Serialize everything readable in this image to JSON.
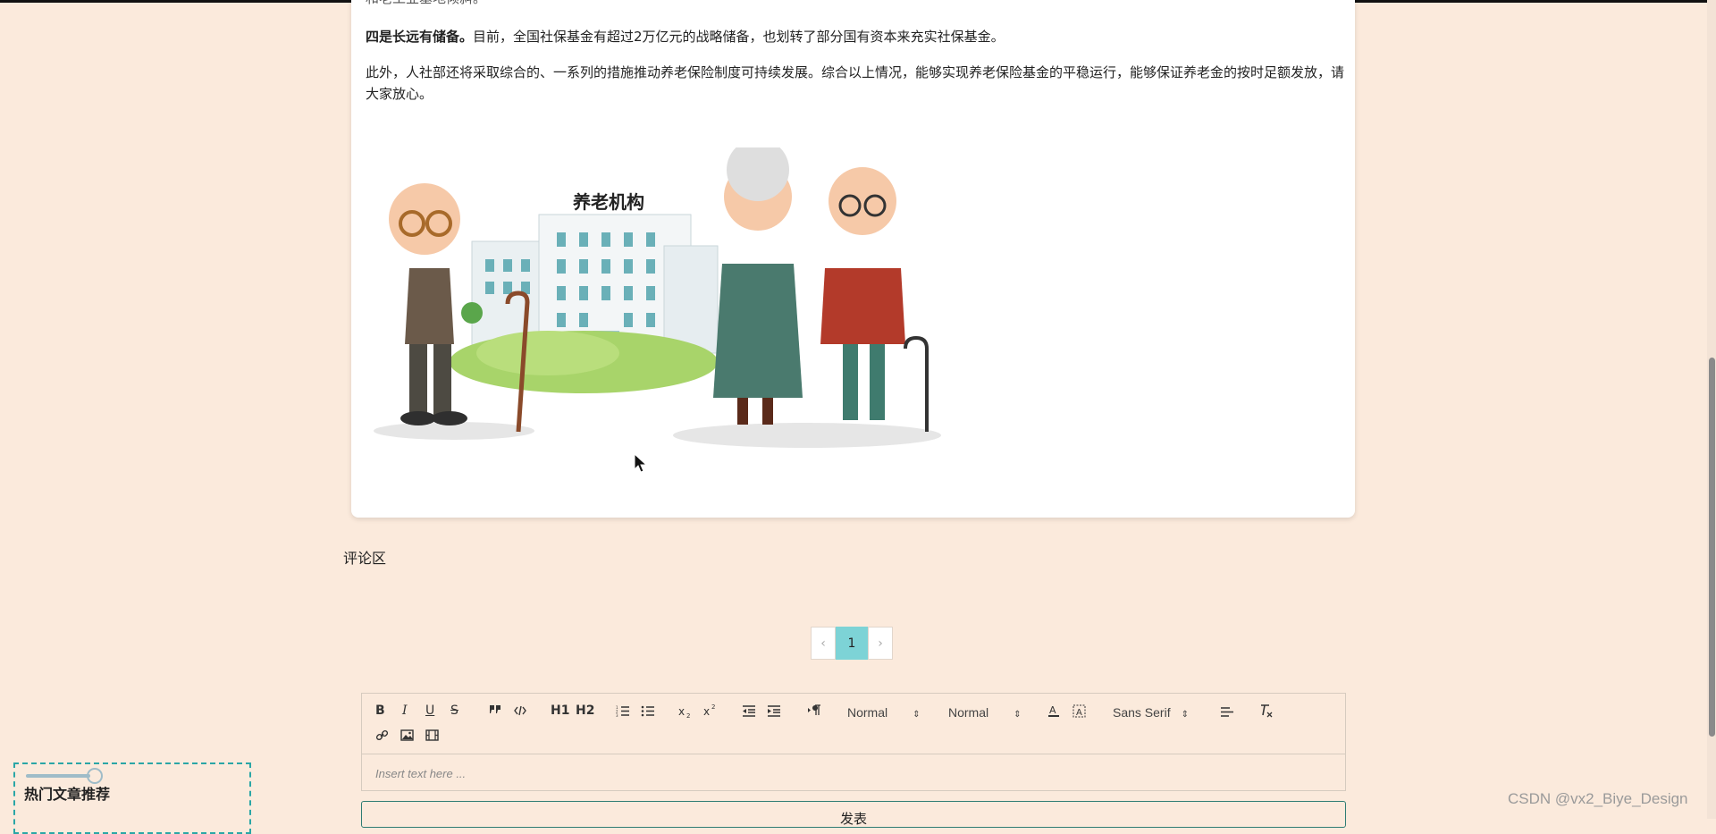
{
  "article": {
    "prev_line": "和老工业基地倾斜。",
    "point4_heading": "四是长远有储备。",
    "point4_text": "目前，全国社保基金有超过2万亿元的战略储备，也划转了部分国有资本来充实社保基金。",
    "closing_text": "此外，人社部还将采取综合的、一系列的措施推动养老保险制度可持续发展。综合以上情况，能够实现养老保险基金的平稳运行，能够保证养老金的按时足额发放，请大家放心。",
    "image_sign_text": "养老机构"
  },
  "comments": {
    "title": "评论区"
  },
  "pagination": {
    "prev": "‹",
    "current": "1",
    "next": "›"
  },
  "editor": {
    "toolbar": {
      "bold": "B",
      "italic": "I",
      "underline": "U",
      "strike": "S",
      "h1": "H1",
      "h2": "H2",
      "header_select": "Normal",
      "size_select": "Normal",
      "font_select": "Sans Serif"
    },
    "placeholder": "Insert text here ...",
    "submit_label": "发表"
  },
  "sidebar": {
    "hot_title": "热门文章推荐"
  },
  "watermark": "CSDN @vx2_Biye_Design"
}
